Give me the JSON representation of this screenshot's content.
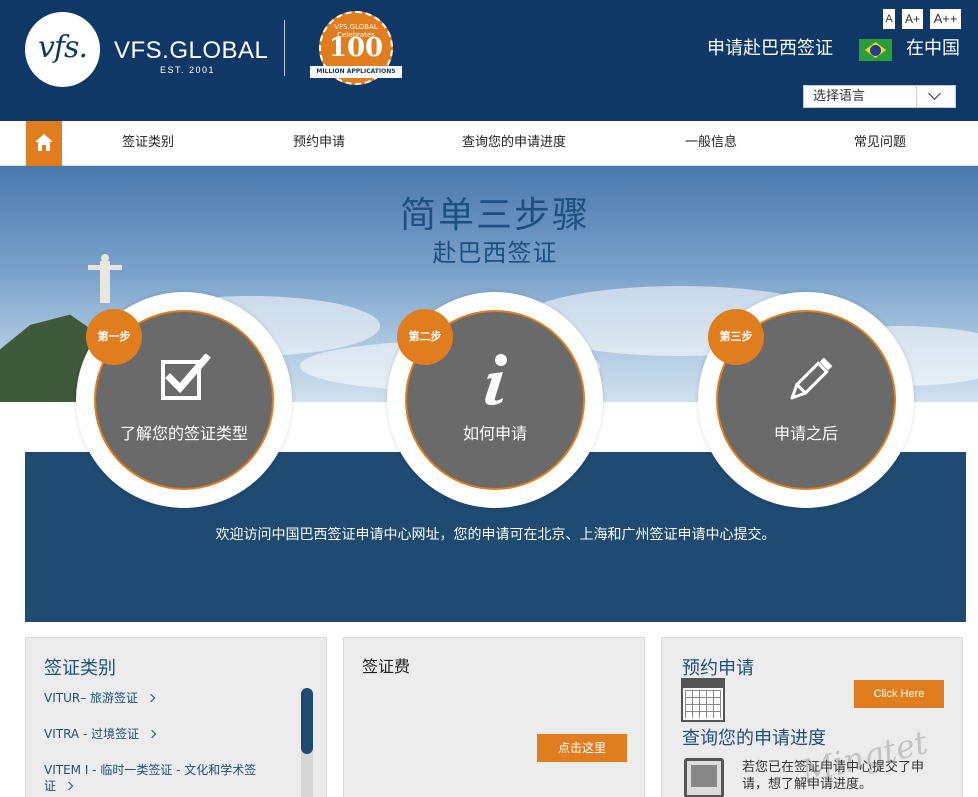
{
  "header": {
    "logo_mark": "vfs.",
    "logo_name": "VFS.GLOBAL",
    "logo_est": "EST. 2001",
    "badge_top": "VFS.GLOBAL Celebrates",
    "badge_number": "100",
    "badge_ribbon": "MILLION APPLICATIONS",
    "font_sizes": [
      "A",
      "A+",
      "A++"
    ],
    "title": "申请赴巴西签证",
    "location": "在中国",
    "language_select": "选择语言",
    "brand_color": "#0f3866"
  },
  "nav": {
    "home_icon": "home-icon",
    "items": [
      "签证类别",
      "预约申请",
      "查询您的申请进度",
      "一般信息",
      "常见问题"
    ],
    "accent": "#e07d1f"
  },
  "hero": {
    "title": "简单三步骤",
    "subtitle": "赴巴西签证"
  },
  "steps": [
    {
      "badge": "第一步",
      "label": "了解您的签证类型",
      "icon": "checkbox-icon"
    },
    {
      "badge": "第二步",
      "label": "如何申请",
      "icon": "info-icon"
    },
    {
      "badge": "第三步",
      "label": "申请之后",
      "icon": "pencil-icon"
    }
  ],
  "welcome": "欢迎访问中国巴西签证申请中心网址，您的申请可在北京、上海和广州签证申请中心提交。",
  "panels": {
    "visa_types": {
      "title": "签证类别",
      "items": [
        "VITUR– 旅游签证",
        "VITRA - 过境签证",
        "VITEM I - 临时一类签证 - 文化和学术签",
        "证"
      ]
    },
    "visa_fee": {
      "title": "签证费",
      "button": "点击这里"
    },
    "appointment": {
      "title": "预约申请",
      "button": "Click Here",
      "track_title": "查询您的申请进度",
      "track_text": "若您已在签证申请中心提交了申请，想了解申请进度。"
    }
  },
  "watermark": "Mingtet"
}
